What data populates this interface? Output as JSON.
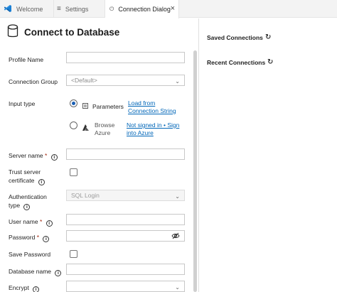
{
  "tabs": [
    {
      "label": "Welcome",
      "icon": "vscode-icon"
    },
    {
      "label": "Settings",
      "icon": "settings-icon"
    },
    {
      "label": "Connection Dialog",
      "icon": "plug-icon",
      "close": "×"
    }
  ],
  "dialog": {
    "title": "Connect to Database",
    "icon": "database-icon"
  },
  "form": {
    "profile_name_label": "Profile Name",
    "connection_group_label": "Connection Group",
    "connection_group_value": "<Default>",
    "input_type_label": "Input type",
    "parameters_label": "Parameters",
    "load_link_line1": "Load from",
    "load_link_line2": "Connection String",
    "browse_azure_line1": "Browse",
    "browse_azure_line2": "Azure",
    "not_signed_line1": "Not signed in • Sign",
    "not_signed_line2": "into Azure",
    "server_name_label": "Server name",
    "trust_cert_line1": "Trust server",
    "trust_cert_line2": "certificate",
    "auth_type_line1": "Authentication",
    "auth_type_line2": "type",
    "auth_type_value": "SQL Login",
    "user_name_label": "User name",
    "password_label": "Password",
    "save_password_label": "Save Password",
    "database_name_label": "Database name",
    "encrypt_label": "Encrypt",
    "required_mark": "*",
    "info_glyph": "i"
  },
  "right_panel": {
    "saved_connections": "Saved Connections",
    "recent_connections": "Recent Connections"
  },
  "colors": {
    "accent": "#0066b8",
    "radio_selected": "#1a5fb4"
  }
}
